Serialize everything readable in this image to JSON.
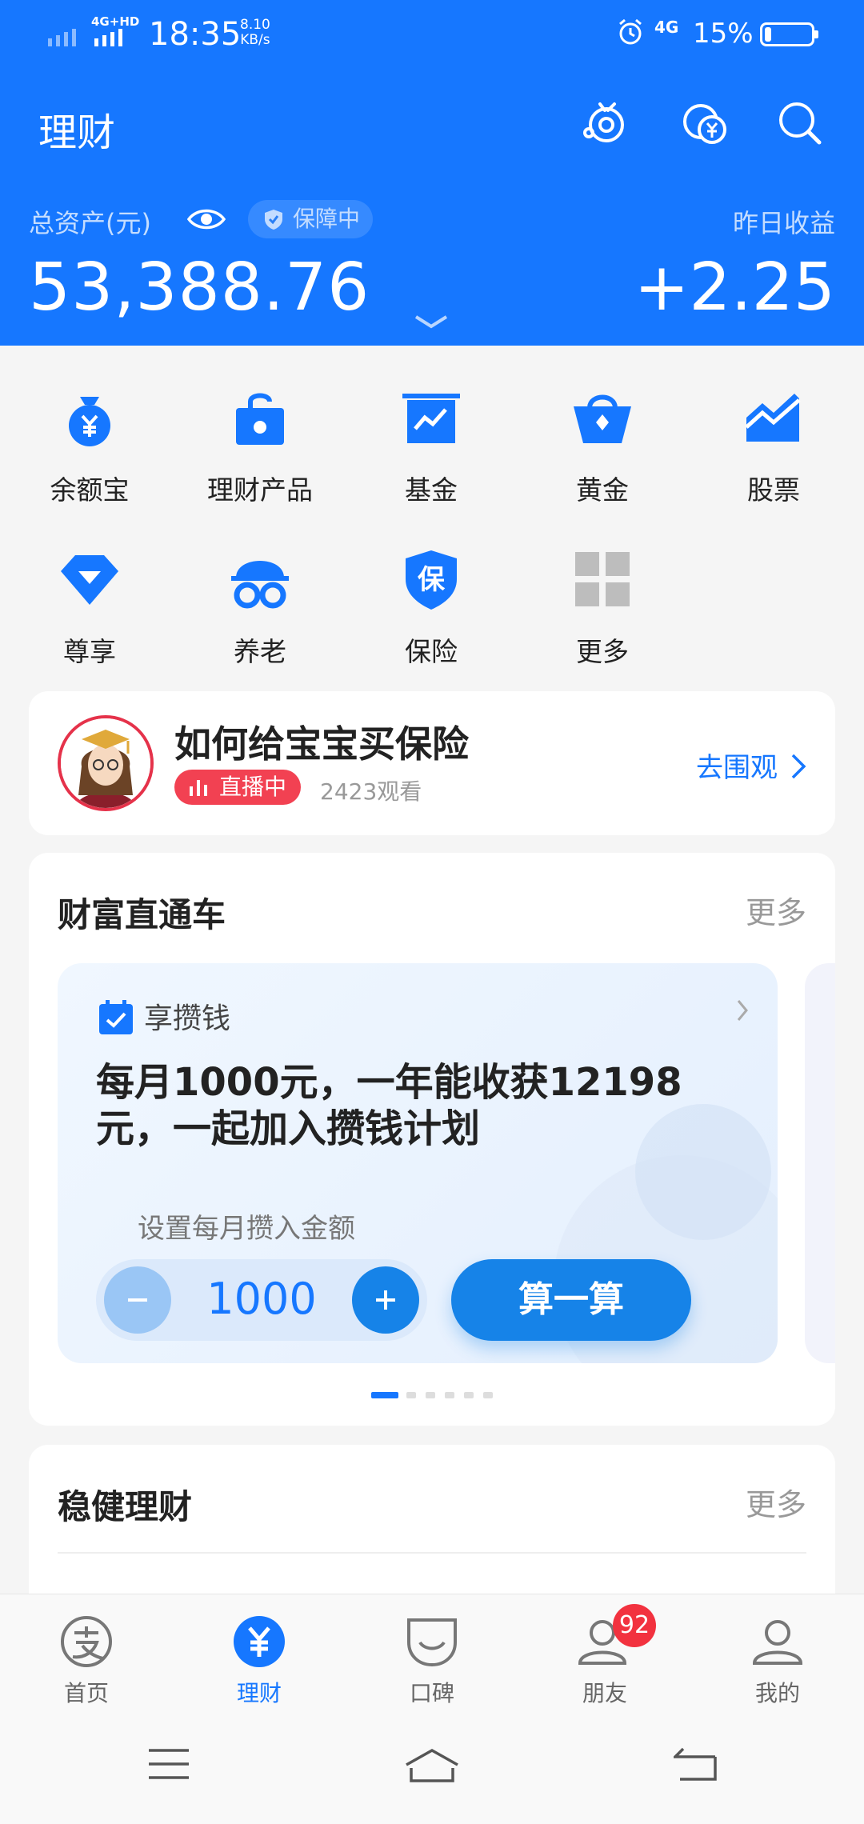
{
  "status_bar": {
    "network_label": "4G+HD",
    "time": "18:35",
    "speed_value": "8.10",
    "speed_unit": "KB/s",
    "network_label_2": "4G",
    "battery_percent": "15%",
    "battery_level": 0.15
  },
  "header": {
    "title": "理财",
    "assets_label": "总资产(元)",
    "guard_label": "保障中",
    "yield_label": "昨日收益",
    "assets_value": "53,388.76",
    "yield_value": "+2.25"
  },
  "grid": [
    {
      "label": "余额宝",
      "icon": "money-bag-icon"
    },
    {
      "label": "理财产品",
      "icon": "lock-bag-icon"
    },
    {
      "label": "基金",
      "icon": "fund-chart-icon"
    },
    {
      "label": "黄金",
      "icon": "gold-basket-icon"
    },
    {
      "label": "股票",
      "icon": "stock-chart-icon"
    },
    {
      "label": "尊享",
      "icon": "diamond-icon"
    },
    {
      "label": "养老",
      "icon": "elder-glasses-icon"
    },
    {
      "label": "保险",
      "icon": "insurance-shield-icon"
    },
    {
      "label": "更多",
      "icon": "more-grid-icon"
    }
  ],
  "live_card": {
    "title": "如何给宝宝买保险",
    "badge": "直播中",
    "viewers": "2423观看",
    "action": "去围观"
  },
  "wealth_express": {
    "title": "财富直通车",
    "more": "更多",
    "plan_name": "享攒钱",
    "plan_text": "每月1000元，一年能收获12198元，一起加入攒钱计划",
    "amount_label": "设置每月攒入金额",
    "amount_value": "1000",
    "calc_button": "算一算",
    "page_count": 6,
    "active_page": 1
  },
  "steady": {
    "title": "稳健理财",
    "more": "更多"
  },
  "tabbar": {
    "tabs": [
      {
        "label": "首页",
        "icon": "alipay-home-icon",
        "active": false
      },
      {
        "label": "理财",
        "icon": "yuan-icon",
        "active": true
      },
      {
        "label": "口碑",
        "icon": "koubei-icon",
        "active": false
      },
      {
        "label": "朋友",
        "icon": "friends-icon",
        "active": false,
        "badge": "92"
      },
      {
        "label": "我的",
        "icon": "profile-icon",
        "active": false
      }
    ]
  },
  "colors": {
    "brand": "#1677ff",
    "live_red": "#f24152",
    "badge_red": "#f2323f"
  }
}
